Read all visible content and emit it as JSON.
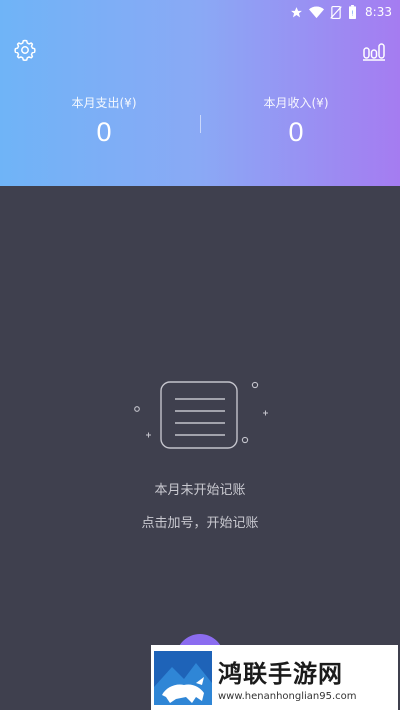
{
  "statusbar": {
    "time": "8:33",
    "icons": [
      "star-icon",
      "wifi-icon",
      "no-sim-icon",
      "battery-icon"
    ]
  },
  "header": {
    "settings_icon": "gear-icon",
    "stats_icon": "bar-chart-icon",
    "expense": {
      "label": "本月支出(¥)",
      "value": "0"
    },
    "income": {
      "label": "本月收入(¥)",
      "value": "0"
    }
  },
  "empty_state": {
    "icon": "notebook-icon",
    "title": "本月未开始记账",
    "hint": "点击加号，开始记账"
  },
  "fab": {
    "icon": "plus-icon"
  },
  "watermark": {
    "title": "鸿联手游网",
    "url": "www.henanhonglian95.com"
  },
  "colors": {
    "header_gradient_start": "#6fb4f7",
    "header_gradient_end": "#a57cf1",
    "background": "#3f404e",
    "fab": "#8b6cf0"
  }
}
